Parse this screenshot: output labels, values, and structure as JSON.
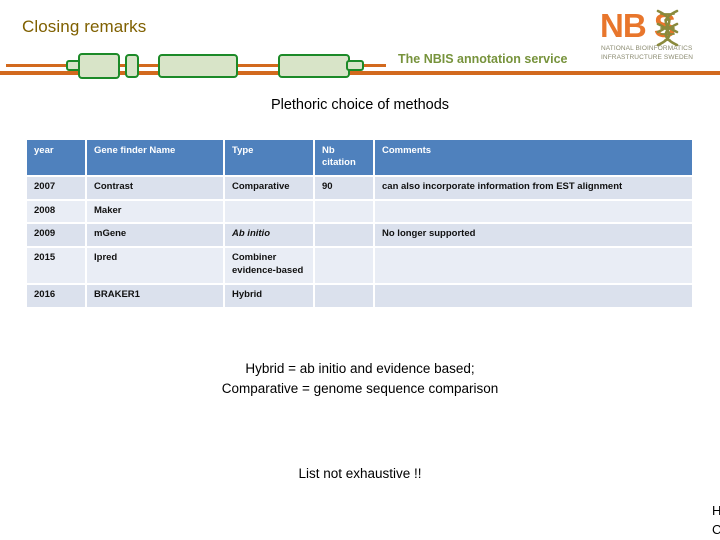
{
  "header": {
    "title": "Closing remarks",
    "subtitle": "The NBIS annotation service",
    "rule_color": "#d2691e",
    "title_color": "#7f6000",
    "subtitle_color": "#77933c"
  },
  "logo": {
    "wordmark": "NB S",
    "tagline_line1": "NATIONAL BIOINFORMATICS",
    "tagline_line2": "INFRASTRUCTURE SWEDEN",
    "brand_color": "#e8762c",
    "helix_color": "#8a8a3c"
  },
  "gene_model": {
    "line_color": "#d2691e",
    "exon_fill": "#d8e4c8",
    "exon_stroke": "#1c8a28"
  },
  "section": {
    "heading": "Plethoric choice of methods"
  },
  "table": {
    "columns": [
      "year",
      "Gene finder Name",
      "Type",
      "Nb citation",
      "Comments"
    ],
    "header_bg": "#4f81bd",
    "row_bg_odd": "#dbe1ed",
    "row_bg_even": "#e9edf5",
    "rows": [
      {
        "year": "2007",
        "name": "Contrast",
        "type": "Comparative",
        "type_italic": false,
        "citation": "90",
        "comments": "can also incorporate information from EST alignment"
      },
      {
        "year": "2008",
        "name": "Maker",
        "type": "",
        "type_italic": false,
        "citation": "",
        "comments": ""
      },
      {
        "year": "2009",
        "name": "mGene",
        "type": "Ab initio",
        "type_italic": true,
        "citation": "",
        "comments": "No longer supported"
      },
      {
        "year": "2015",
        "name": "Ipred",
        "type": "Combiner evidence-based",
        "type_italic": false,
        "citation": "",
        "comments": ""
      },
      {
        "year": "2016",
        "name": "BRAKER1",
        "type": "Hybrid",
        "type_italic": false,
        "citation": "",
        "comments": ""
      }
    ]
  },
  "notes": {
    "legend_line1": "Hybrid = ab initio and evidence based;",
    "legend_line2": "Comparative = genome sequence comparison",
    "exhaustive": "List not exhaustive !!"
  },
  "corner": {
    "clipped_line1": "H",
    "clipped_line2": "C"
  }
}
